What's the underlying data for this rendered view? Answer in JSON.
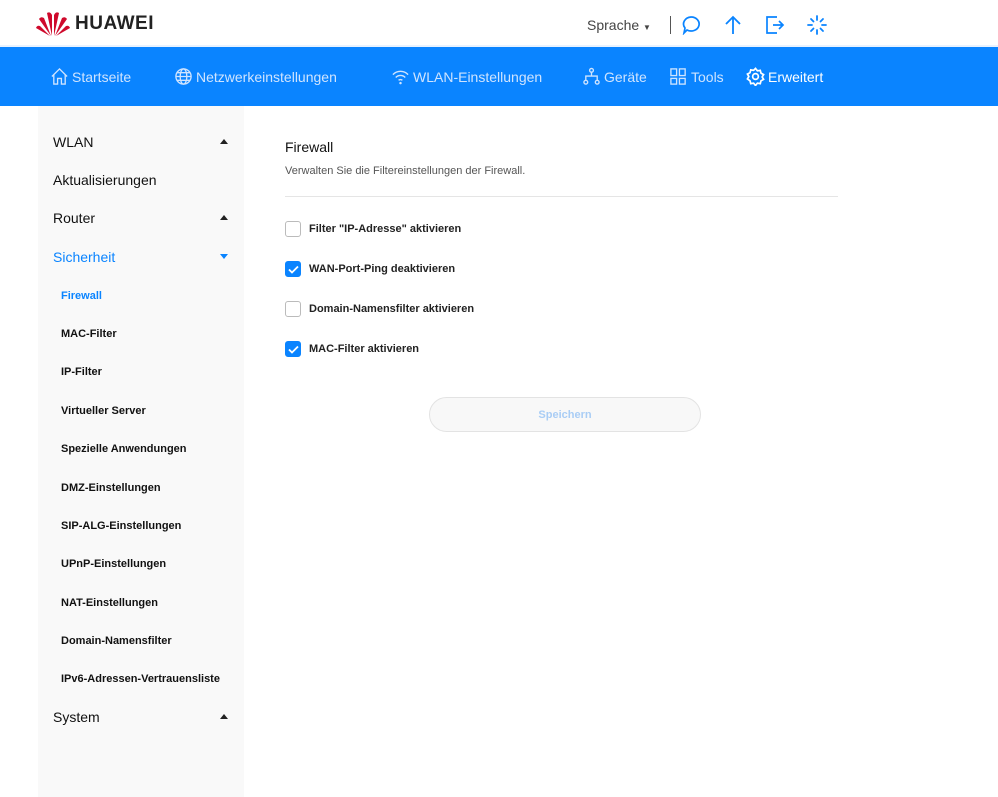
{
  "header": {
    "brand": "HUAWEI",
    "language": "Sprache"
  },
  "nav": [
    {
      "label": "Startseite",
      "icon": "home-icon"
    },
    {
      "label": "Netzwerkeinstellungen",
      "icon": "globe-icon"
    },
    {
      "label": "WLAN-Einstellungen",
      "icon": "wifi-icon"
    },
    {
      "label": "Geräte",
      "icon": "devices-icon"
    },
    {
      "label": "Tools",
      "icon": "grid-icon"
    },
    {
      "label": "Erweitert",
      "icon": "gear-icon",
      "active": true
    }
  ],
  "sidebar": {
    "groups": {
      "wlan": "WLAN",
      "updates": "Aktualisierungen",
      "router": "Router",
      "security": "Sicherheit",
      "system": "System"
    },
    "security_items": [
      "Firewall",
      "MAC-Filter",
      "IP-Filter",
      "Virtueller Server",
      "Spezielle Anwendungen",
      "DMZ-Einstellungen",
      "SIP-ALG-Einstellungen",
      "UPnP-Einstellungen",
      "NAT-Einstellungen",
      "Domain-Namensfilter",
      "IPv6-Adressen-Vertrauensliste"
    ]
  },
  "main": {
    "title": "Firewall",
    "description": "Verwalten Sie die Filtereinstellungen der Firewall.",
    "options": [
      {
        "label": "Filter \"IP-Adresse\" aktivieren",
        "checked": false
      },
      {
        "label": "WAN-Port-Ping deaktivieren",
        "checked": true
      },
      {
        "label": "Domain-Namensfilter aktivieren",
        "checked": false
      },
      {
        "label": "MAC-Filter aktivieren",
        "checked": true
      }
    ],
    "save_label": "Speichern"
  },
  "colors": {
    "accent": "#0a84ff",
    "brand": "#cf0a2c"
  }
}
